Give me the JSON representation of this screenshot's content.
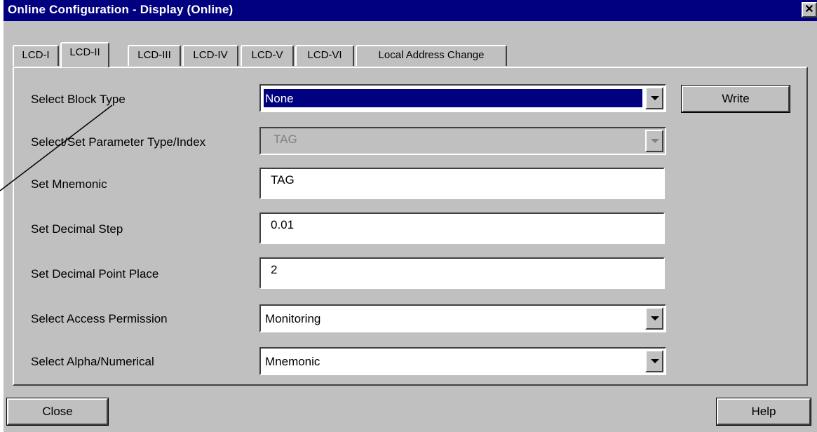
{
  "window": {
    "title": "Online Configuration - Display  (Online)",
    "close_glyph": "✕"
  },
  "tabs": [
    {
      "label": "LCD-I",
      "active": false
    },
    {
      "label": "LCD-II",
      "active": true
    },
    {
      "label": "LCD-III",
      "active": false
    },
    {
      "label": "LCD-IV",
      "active": false
    },
    {
      "label": "LCD-V",
      "active": false
    },
    {
      "label": "LCD-VI",
      "active": false
    },
    {
      "label": "Local Address Change",
      "active": false
    }
  ],
  "form": {
    "block_type": {
      "label": "Select Block Type",
      "value": "None"
    },
    "param_type": {
      "label": "Select/Set Parameter Type/Index",
      "value": "TAG"
    },
    "mnemonic": {
      "label": "Set Mnemonic",
      "value": "TAG"
    },
    "decimal_step": {
      "label": "Set Decimal Step",
      "value": "0.01"
    },
    "decimal_point": {
      "label": "Set Decimal Point Place",
      "value": "2"
    },
    "access": {
      "label": "Select Access Permission",
      "value": "Monitoring"
    },
    "alpha": {
      "label": "Select Alpha/Numerical",
      "value": "Mnemonic"
    }
  },
  "buttons": {
    "write": "Write",
    "close": "Close",
    "help": "Help"
  }
}
